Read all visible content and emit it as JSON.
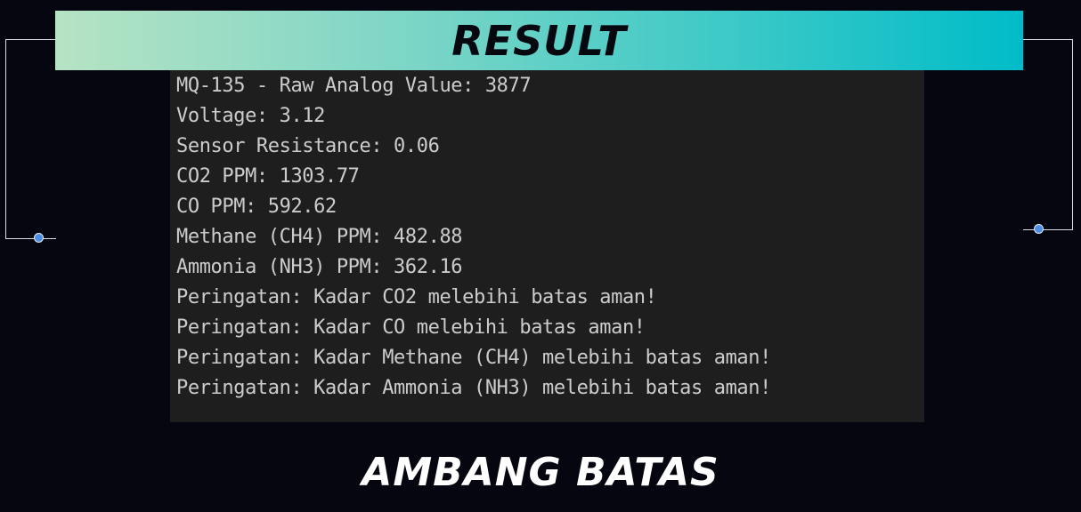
{
  "header": {
    "title": "RESULT"
  },
  "console": {
    "lines": [
      "MQ-135 - Raw Analog Value: 3877",
      "Voltage: 3.12",
      "Sensor Resistance: 0.06",
      "CO2 PPM: 1303.77",
      "CO PPM: 592.62",
      "Methane (CH4) PPM: 482.88",
      "Ammonia (NH3) PPM: 362.16",
      "Peringatan: Kadar CO2 melebihi batas aman!",
      "Peringatan: Kadar CO melebihi batas aman!",
      "Peringatan: Kadar Methane (CH4) melebihi batas aman!",
      "Peringatan: Kadar Ammonia (NH3) melebihi batas aman!"
    ]
  },
  "footer": {
    "title": "AMBANG BATAS"
  },
  "colors": {
    "background": "#05060f",
    "banner_gradient_start": "#b6e3c4",
    "banner_gradient_end": "#00bcc8",
    "console_background": "#1e1e1e",
    "console_text": "#cccccc",
    "connector_dot": "#4d8fe6"
  }
}
